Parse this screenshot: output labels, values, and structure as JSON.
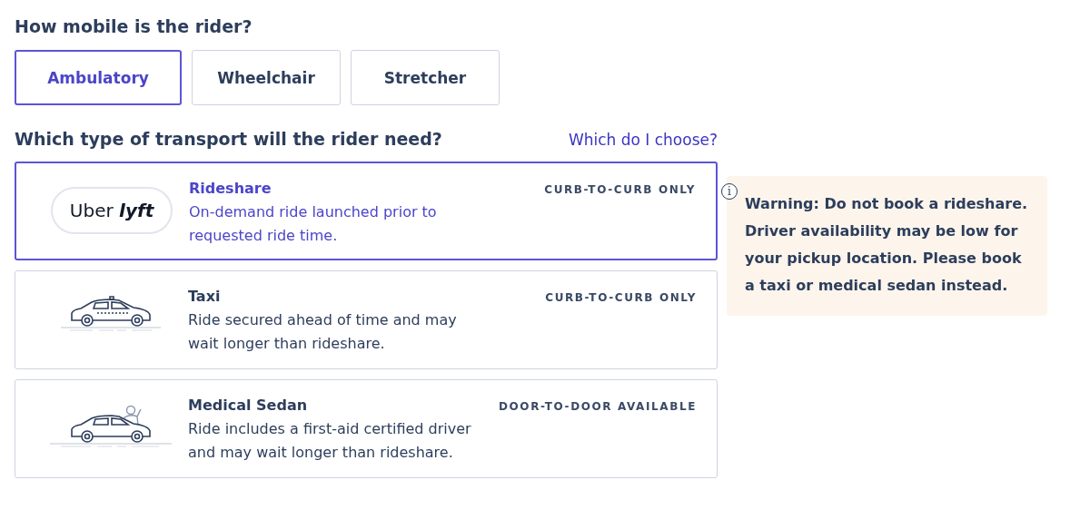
{
  "mobility": {
    "question": "How mobile is the rider?",
    "options": [
      {
        "label": "Ambulatory",
        "selected": true
      },
      {
        "label": "Wheelchair",
        "selected": false
      },
      {
        "label": "Stretcher",
        "selected": false
      }
    ]
  },
  "transport": {
    "question": "Which type of transport will the rider need?",
    "help_link": "Which do I choose?",
    "options": [
      {
        "kind": "rideshare",
        "logo": [
          "Uber",
          "lyft"
        ],
        "title": "Rideshare",
        "description": "On-demand ride launched prior to requested ride time.",
        "tag": "CURB-TO-CURB ONLY",
        "selected": true
      },
      {
        "kind": "taxi",
        "title": "Taxi",
        "description": "Ride secured ahead of time and may wait longer than rideshare.",
        "tag": "CURB-TO-CURB ONLY",
        "selected": false
      },
      {
        "kind": "sedan",
        "title": "Medical Sedan",
        "description": "Ride includes a first-aid certified driver and may wait longer than rideshare.",
        "tag": "DOOR-TO-DOOR AVAILABLE",
        "selected": false
      }
    ]
  },
  "warning": {
    "icon": "i",
    "text": "Warning: Do not book a rideshare. Driver availability may be low for your pickup location. Please book a taxi or medical sedan instead."
  }
}
